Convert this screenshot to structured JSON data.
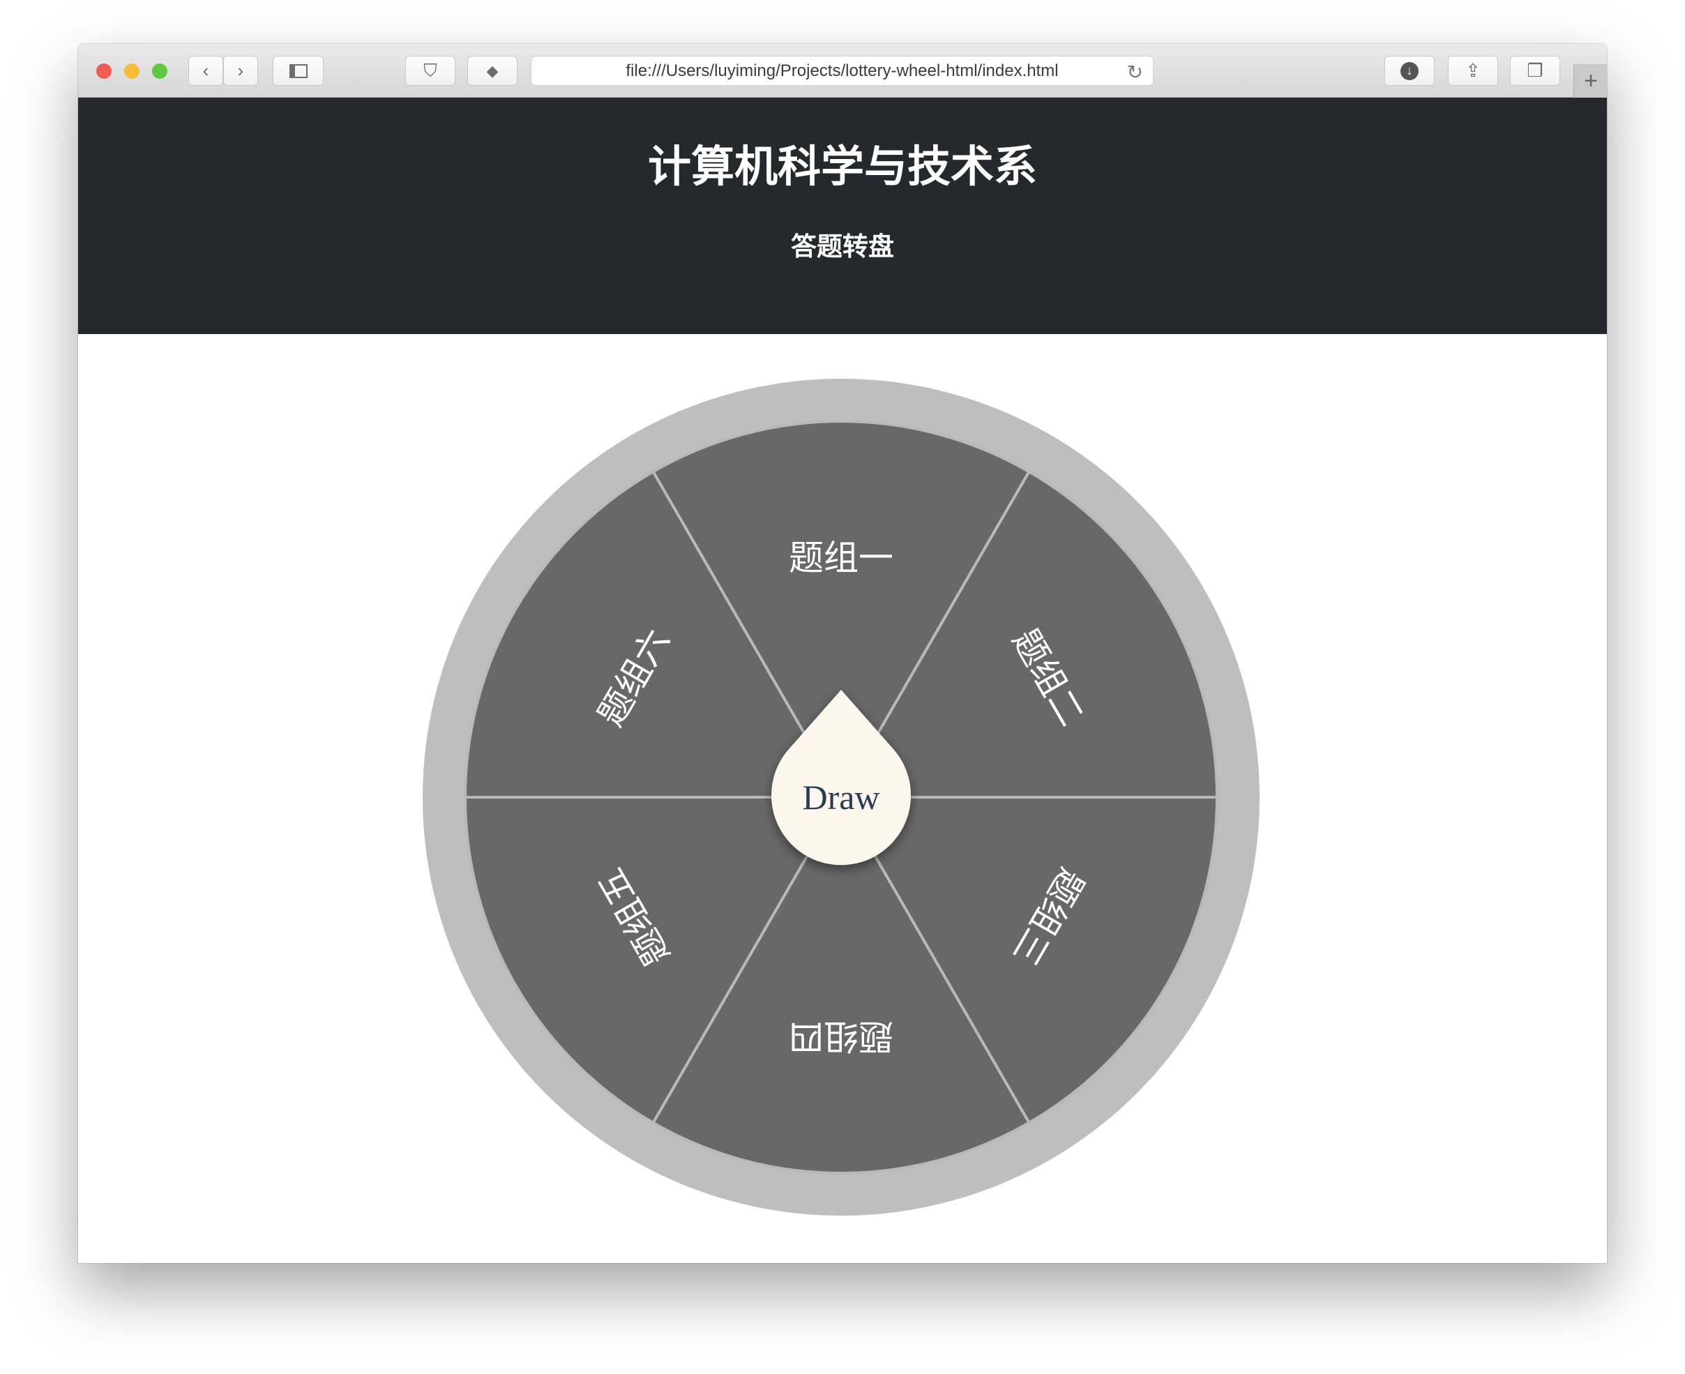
{
  "browser": {
    "url": "file:///Users/luyiming/Projects/lottery-wheel-html/index.html",
    "icons": [
      "close-light",
      "minimize-light",
      "zoom-light",
      "chevron-left-icon",
      "chevron-right-icon",
      "sidebar-icon",
      "shield-icon",
      "evernote-icon",
      "reload-icon",
      "download-icon",
      "share-icon",
      "tabs-icon",
      "plus-icon"
    ]
  },
  "header": {
    "title": "计算机科学与技术系",
    "subtitle": "答题转盘"
  },
  "wheel": {
    "segments": [
      "题组一",
      "题组二",
      "题组三",
      "题组四",
      "题组五",
      "题组六"
    ],
    "draw_label": "Draw",
    "colors": {
      "rim": "#bebebe",
      "segment": "#686868",
      "divider": "#b9b9b9",
      "button": "#fdf6ec",
      "button_text": "#2c3e55",
      "header_bg": "#25282d"
    }
  }
}
